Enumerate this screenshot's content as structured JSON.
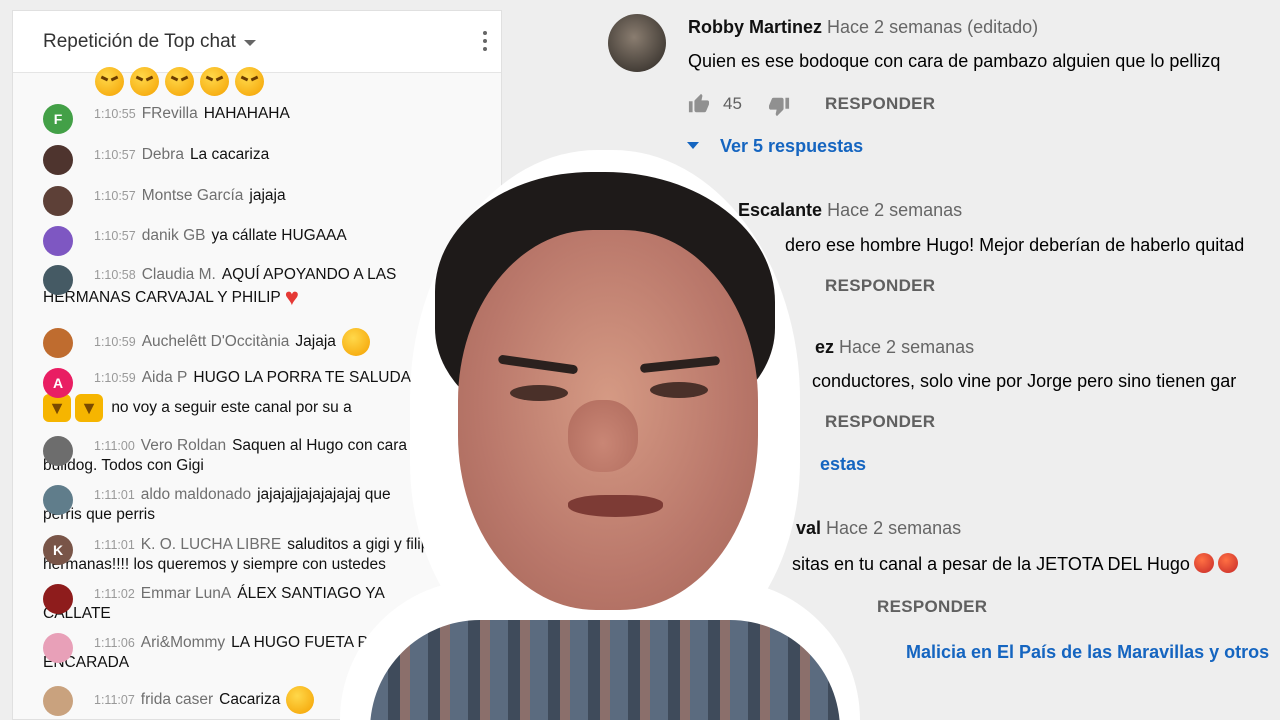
{
  "chat": {
    "header_title": "Repetición de Top chat",
    "messages": [
      {
        "avatar_letter": "F",
        "avatar_color": "#43a047",
        "time": "1:10:55",
        "author": "FRevilla",
        "text": "HAHAHAHA"
      },
      {
        "avatar_letter": "",
        "avatar_color": "#4e342e",
        "time": "1:10:57",
        "author": "Debra",
        "text": "La cacariza"
      },
      {
        "avatar_letter": "",
        "avatar_color": "#5d4037",
        "time": "1:10:57",
        "author": "Montse García",
        "text": "jajaja"
      },
      {
        "avatar_letter": "",
        "avatar_color": "#7e57c2",
        "time": "1:10:57",
        "author": "danik GB",
        "text": "ya cállate HUGAAA"
      },
      {
        "avatar_letter": "",
        "avatar_color": "#455a64",
        "time": "1:10:58",
        "author": "Claudia M.",
        "text": "AQUÍ APOYANDO A LAS",
        "text2": "HERMANAS CARVAJAL Y PHILIP"
      },
      {
        "avatar_letter": "",
        "avatar_color": "#bf6c2f",
        "time": "1:10:59",
        "author": "Auchelêtt D'Occitània",
        "text": "Jajaja"
      },
      {
        "avatar_letter": "A",
        "avatar_color": "#e91e63",
        "time": "1:10:59",
        "author": "Aida P",
        "text": "HUGO LA PORRA TE SALUDA",
        "text2": "no voy a seguir este canal por su a"
      },
      {
        "avatar_letter": "",
        "avatar_color": "#6d6d6d",
        "time": "1:11:00",
        "author": "Vero Roldan",
        "text": "Saquen al Hugo con cara",
        "text2": "bulldog. Todos con Gigi"
      },
      {
        "avatar_letter": "",
        "avatar_color": "#607d8b",
        "time": "1:11:01",
        "author": "aldo maldonado",
        "text": "jajajajjajajajajaj que",
        "text2": "perris que perris"
      },
      {
        "avatar_letter": "K",
        "avatar_color": "#795548",
        "time": "1:11:01",
        "author": "K. O. LUCHA LIBRE",
        "text": "saluditos a gigi y filip",
        "text2": "hermanas!!!! los queremos y siempre con ustedes"
      },
      {
        "avatar_letter": "",
        "avatar_color": "#8e1c1c",
        "time": "1:11:02",
        "author": "Emmar LunA",
        "text": "ÁLEX SANTIAGO YA",
        "text2": "CÁLLATE"
      },
      {
        "avatar_letter": "",
        "avatar_color": "#e8a0b8",
        "time": "1:11:06",
        "author": "Ari&Mommy",
        "text": "LA HUGO FUETA POR M",
        "text2": "ENCARADA"
      },
      {
        "avatar_letter": "",
        "avatar_color": "#c9a27e",
        "time": "1:11:07",
        "author": "frida caser",
        "text": "Cacariza"
      }
    ]
  },
  "comments": [
    {
      "author": "Robby Martinez",
      "date": "Hace 2 semanas (editado)",
      "text": "Quien es ese bodoque con cara de pambazo alguien que lo pellizq",
      "likes": "45",
      "reply": "RESPONDER",
      "replies_link": "Ver 5 respuestas"
    },
    {
      "author": "ia Escalante",
      "date": "Hace 2 semanas",
      "text": "dero ese hombre Hugo! Mejor deberían de haberlo quitad",
      "reply": "RESPONDER"
    },
    {
      "author": "ez",
      "date": "Hace 2 semanas",
      "text": "conductores, solo vine por Jorge pero sino tienen gar",
      "reply": "RESPONDER",
      "replies_link": "estas"
    },
    {
      "author": "val",
      "date": "Hace 2 semanas",
      "text": "sitas en tu canal a pesar de la JETOTA DEL Hugo",
      "reply": "RESPONDER"
    },
    {
      "link_text": "Malicia en El País de las Maravillas y otros"
    }
  ]
}
